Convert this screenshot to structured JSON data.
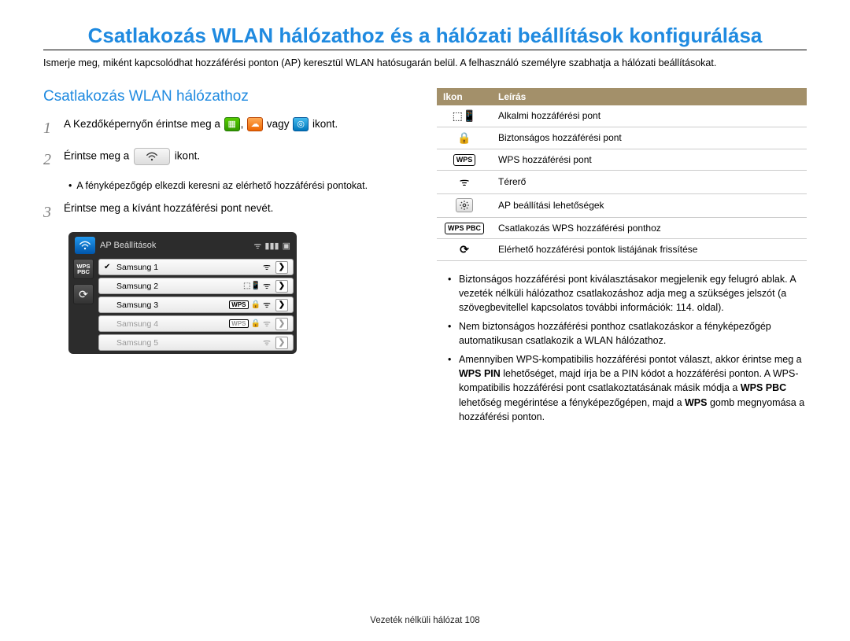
{
  "title": "Csatlakozás WLAN hálózathoz és a hálózati beállítások konfigurálása",
  "intro": "Ismerje meg, miként kapcsolódhat hozzáférési ponton (AP) keresztül WLAN hatósugarán belül. A felhasználó személyre szabhatja a hálózati beállításokat.",
  "subhead": "Csatlakozás WLAN hálózathoz",
  "steps": {
    "s1a": "A Kezdőképernyőn érintse meg a ",
    "s1b": " vagy ",
    "s1c": " ikont.",
    "s2a": "Érintse meg a ",
    "s2b": " ikont.",
    "s2_note": "A fényképezőgép elkezdi keresni az elérhető hozzáférési pontokat.",
    "s3": "Érintse meg a kívánt hozzáférési pont nevét."
  },
  "camera": {
    "title": "AP Beállítások",
    "wps": "WPS\nPBC",
    "rows": [
      {
        "name": "Samsung 1",
        "checked": true,
        "wps": false,
        "lock": false,
        "dim": false,
        "phone": false
      },
      {
        "name": "Samsung 2",
        "checked": false,
        "wps": false,
        "lock": false,
        "dim": false,
        "phone": true
      },
      {
        "name": "Samsung 3",
        "checked": false,
        "wps": true,
        "lock": true,
        "dim": false,
        "phone": false
      },
      {
        "name": "Samsung 4",
        "checked": false,
        "wps": true,
        "lock": true,
        "dim": true,
        "phone": false
      },
      {
        "name": "Samsung 5",
        "checked": false,
        "wps": false,
        "lock": false,
        "dim": true,
        "phone": false
      }
    ]
  },
  "table": {
    "h1": "Ikon",
    "h2": "Leírás",
    "rows": [
      {
        "k": "phone",
        "t": "Alkalmi hozzáférési pont"
      },
      {
        "k": "lock",
        "t": "Biztonságos hozzáférési pont"
      },
      {
        "k": "wps",
        "t": "WPS hozzáférési pont"
      },
      {
        "k": "wifi",
        "t": "Térerő"
      },
      {
        "k": "gear",
        "t": "AP beállítási lehetőségek"
      },
      {
        "k": "wpspbc",
        "t": "Csatlakozás WPS hozzáférési ponthoz"
      },
      {
        "k": "refresh",
        "t": "Elérhető hozzáférési pontok listájának frissítése"
      }
    ]
  },
  "notes": {
    "n1": "Biztonságos hozzáférési pont kiválasztásakor megjelenik egy felugró ablak. A vezeték nélküli hálózathoz csatlakozáshoz adja meg a szükséges jelszót (a szövegbevitellel kapcsolatos további információk: 114. oldal).",
    "n2": "Nem biztonságos hozzáférési ponthoz csatlakozáskor a fényképezőgép automatikusan csatlakozik a WLAN hálózathoz.",
    "n3a": "Amennyiben WPS-kompatibilis hozzáférési pontot választ, akkor érintse meg a ",
    "n3b": "WPS PIN",
    "n3c": " lehetőséget, majd írja be a PIN kódot a hozzáférési ponton. A WPS-kompatibilis hozzáférési pont csatlakoztatásának másik módja a ",
    "n3d": "WPS PBC",
    "n3e": " lehetőség megérintése a fényképezőgépen, majd a ",
    "n3f": "WPS",
    "n3g": " gomb megnyomása a hozzáférési ponton."
  },
  "footer": {
    "a": "Vezeték nélküli hálózat  ",
    "b": "108"
  }
}
